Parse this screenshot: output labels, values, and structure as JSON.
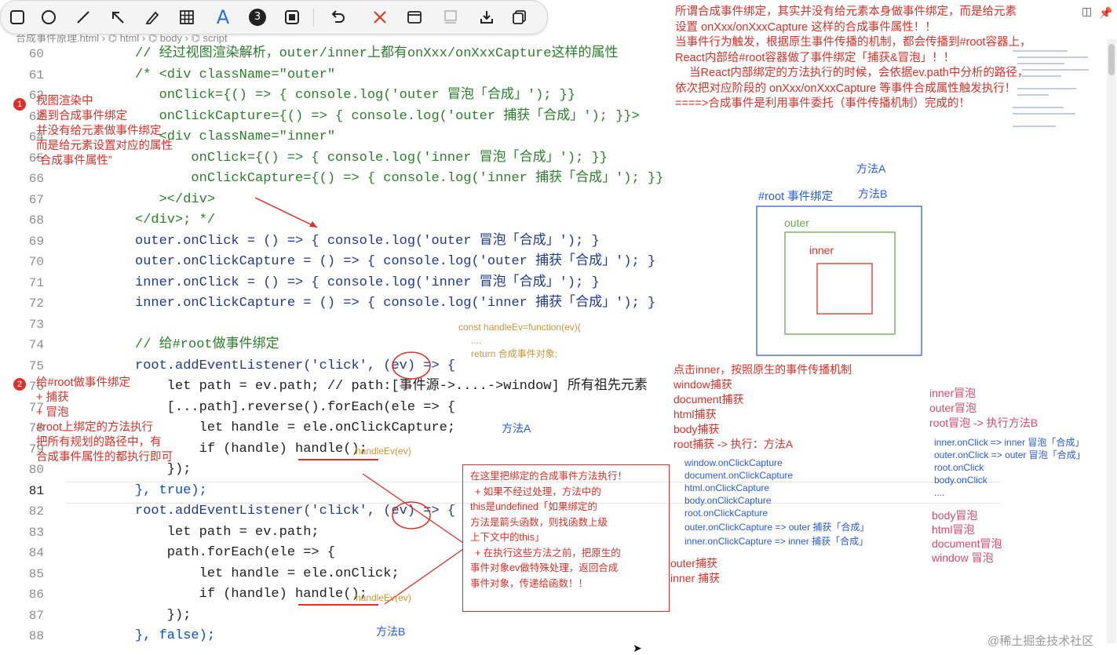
{
  "toolbar": {
    "tools": [
      "square-icon",
      "circle-icon",
      "line-icon",
      "arrow-icon",
      "pen-icon",
      "grid-icon",
      "text-icon",
      "step-icon",
      "frame-icon",
      "undo-icon",
      "close-icon",
      "window-icon",
      "stamp-icon",
      "download-icon",
      "copy-icon"
    ],
    "text_tool_label": "A",
    "step_label": "3"
  },
  "breadcrumb": {
    "file": "合成事件原理.html",
    "path": [
      "html",
      "body",
      "script"
    ]
  },
  "editor": {
    "line_numbers": [
      "60",
      "61",
      "62",
      "63",
      "64",
      "65",
      "66",
      "67",
      "68",
      "69",
      "70",
      "71",
      "72",
      "73",
      "74",
      "75",
      "76",
      "77",
      "78",
      "79",
      "80",
      "81",
      "82",
      "83",
      "84",
      "85",
      "86",
      "87",
      "88"
    ],
    "active_line": "81",
    "lines": [
      "// 经过视图渲染解析，outer/inner上都有onXxx/onXxxCapture这样的属性",
      "/* <div className=\"outer\"",
      "   onClick={() => { console.log('outer 冒泡「合成」'); }}",
      "   onClickCapture={() => { console.log('outer 捕获「合成」'); }}>",
      "   <div className=\"inner\"",
      "       onClick={() => { console.log('inner 冒泡「合成」'); }}",
      "       onClickCapture={() => { console.log('inner 捕获「合成」'); }}",
      "   ></div>",
      "</div>; */",
      "outer.onClick = () => { console.log('outer 冒泡「合成」'); }",
      "outer.onClickCapture = () => { console.log('outer 捕获「合成」'); }",
      "inner.onClick = () => { console.log('inner 冒泡「合成」'); }",
      "inner.onClickCapture = () => { console.log('inner 捕获「合成」'); }",
      "",
      "// 给#root做事件绑定",
      "root.addEventListener('click', (ev) => {",
      "    let path = ev.path; // path:[事件源->....->window] 所有祖先元素",
      "    [...path].reverse().forEach(ele => {",
      "        let handle = ele.onClickCapture;",
      "        if (handle) handle();",
      "    });",
      "}, true);",
      "root.addEventListener('click', (ev) => {",
      "    let path = ev.path;",
      "    path.forEach(ele => {",
      "        let handle = ele.onClick;",
      "        if (handle) handle();",
      "    });",
      "}, false);"
    ]
  },
  "annotations": {
    "top_right": [
      "所谓合成事件绑定，其实并没有给元素本身做事件绑定，而是给元素",
      "设置 onXxx/onXxxCapture 这样的合成事件属性！！",
      "当事件行为触发，根据原生事件传播的机制，都会传播到#root容器上，",
      "React内部给#root容器做了事件绑定「捕获&冒泡」！！",
      "当React内部绑定的方法执行的时候，会依据ev.path中分析的路径，",
      "依次把对应阶段的 onXxx/onXxxCapture 等事件合成属性触发执行！",
      "====>合成事件是利用事件委托（事件传播机制）完成的！"
    ],
    "badge1": "1",
    "note1": [
      "视图渲染中",
      "遇到合成事件绑定",
      "并没有给元素做事件绑定",
      "而是给元素设置对应的属性",
      "“合成事件属性”"
    ],
    "badge2": "2",
    "note2": [
      "给#root做事件绑定",
      "+ 捕获",
      "+ 冒泡",
      "#root上绑定的方法执行",
      "把所有规划的路径中，有",
      "合成事件属性的都执行即可"
    ],
    "handle_ev": [
      "const handleEv=function(ev){",
      "....",
      "return 合成事件对象;"
    ],
    "handle_inline_1": "handleEv(ev)",
    "handle_inline_2": "handleEv(ev)",
    "method_a_mid": "方法A",
    "method_b_bottom": "方法B",
    "red_box": [
      "在这里把绑定的合成事件方法执行！",
      "+ 如果不经过处理，方法中的",
      "this是undefined「如果绑定的",
      "方法是箭头函数，则找函数上级",
      "上下文中的this」",
      "+ 在执行这些方法之前，把原生的",
      "事件对象ev做特殊处理，返回合成",
      "事件对象，传递给函数！！"
    ],
    "diagram": {
      "method_a": "方法A",
      "method_b": "方法B",
      "root_label": "#root 事件绑定",
      "outer_label": "outer",
      "inner_label": "inner"
    },
    "capture_flow": [
      "点击inner，按照原生的事件传播机制",
      "window捕获",
      "document捕获",
      "html捕获",
      "body捕获",
      "root捕获 -> 执行：方法A"
    ],
    "capture_list": [
      "window.onClickCapture",
      "document.onClickCapture",
      "html.onClickCapture",
      "body.onClickCapture",
      "root.onClickCapture",
      "outer.onClickCapture  => outer 捕获「合成」",
      "inner.onClickCapture  => inner 捕获「合成」"
    ],
    "capture_tail": [
      "outer捕获",
      "inner 捕获"
    ],
    "bubble_flow": [
      "inner冒泡",
      "outer冒泡",
      "root冒泡 -> 执行方法B"
    ],
    "bubble_list": [
      "inner.onClick => inner 冒泡「合成」",
      "outer.onClick => outer 冒泡「合成」",
      "root.onClick",
      "body.onClick",
      "...."
    ],
    "bubble_tail": [
      "body冒泡",
      "html冒泡",
      "document冒泡",
      "window 冒泡"
    ],
    "watermark": "@稀土掘金技术社区"
  },
  "colors": {
    "red": "#d8322a",
    "blue": "#2a5bd7",
    "pink": "#d84a6a",
    "green": "#6aa84f",
    "keyword": "#0a50c0",
    "string": "#a31515",
    "comment": "#2d7d2d"
  }
}
